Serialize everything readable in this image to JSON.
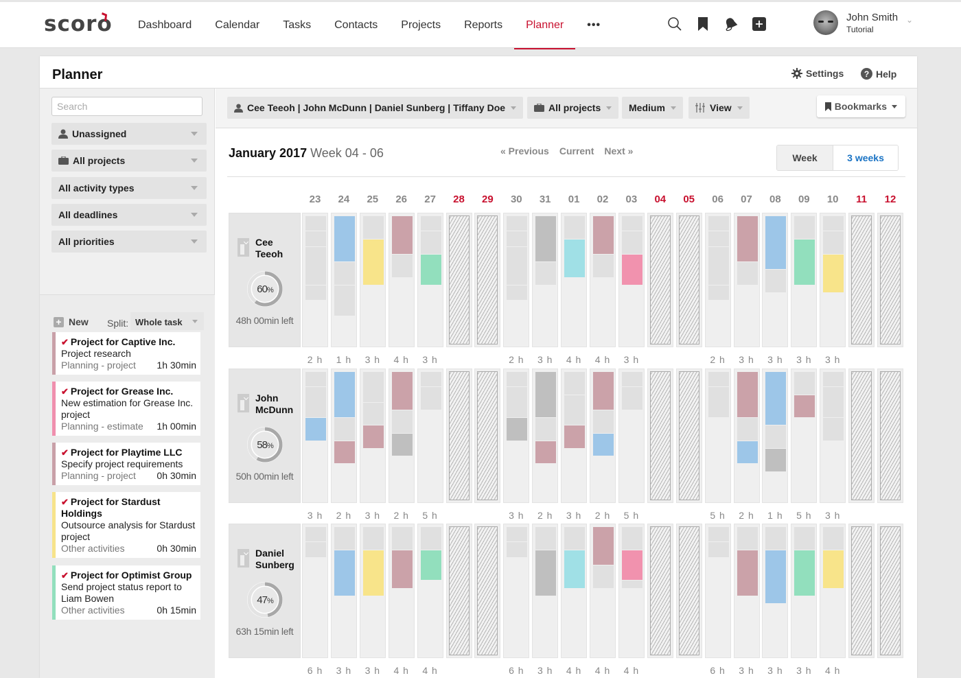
{
  "app": {
    "logo": "scoro",
    "nav": [
      {
        "label": "Dashboard",
        "active": false
      },
      {
        "label": "Calendar",
        "active": false
      },
      {
        "label": "Tasks",
        "active": false
      },
      {
        "label": "Contacts",
        "active": false
      },
      {
        "label": "Projects",
        "active": false
      },
      {
        "label": "Reports",
        "active": false
      },
      {
        "label": "Planner",
        "active": true
      }
    ],
    "nav_more": "•••",
    "icons": [
      "search-icon",
      "bookmark-icon",
      "bell-icon",
      "add-icon"
    ],
    "user": {
      "name": "John Smith",
      "role": "Tutorial"
    }
  },
  "page": {
    "title": "Planner",
    "settings_label": "Settings",
    "help_label": "Help"
  },
  "sidebar": {
    "search_placeholder": "Search",
    "filters": [
      {
        "label": "Unassigned",
        "icon": "user-icon"
      },
      {
        "label": "All projects",
        "icon": "briefcase-icon"
      },
      {
        "label": "All activity types",
        "icon": ""
      },
      {
        "label": "All deadlines",
        "icon": ""
      },
      {
        "label": "All priorities",
        "icon": ""
      }
    ],
    "new_label": "New",
    "split_label": "Split:",
    "split_value": "Whole task",
    "tasks": [
      {
        "project": "Project for Captive Inc.",
        "desc": "Project research",
        "type": "Planning - project",
        "time": "1h 30min",
        "color": "#c9a0a8"
      },
      {
        "project": "Project for Grease Inc.",
        "desc": "New estimation for Grease Inc. project",
        "type": "Planning - estimate",
        "time": "1h 00min",
        "color": "#f08fae"
      },
      {
        "project": "Project for Playtime LLC",
        "desc": "Specify project requirements",
        "type": "Planning - project",
        "time": "0h 30min",
        "color": "#c9a0a8"
      },
      {
        "project": "Project for Stardust Holdings",
        "desc": "Outsource analysis for Stardust project",
        "type": "Other activities",
        "time": "0h 30min",
        "color": "#f7e38a"
      },
      {
        "project": "Project for Optimist Group",
        "desc": "Send project status report to Liam Bowen",
        "type": "Other activities",
        "time": "0h 15min",
        "color": "#92dfbd"
      }
    ]
  },
  "toolbar": {
    "users_label": "Cee Teeoh | John McDunn | Daniel Sunberg | Tiffany Doe",
    "projects_label": "All projects",
    "size_label": "Medium",
    "view_label": "View",
    "bookmarks_label": "Bookmarks"
  },
  "period": {
    "month": "January 2017",
    "weeks": "Week 04 - 06",
    "prev_label": "« Previous",
    "current_label": "Current",
    "next_label": "Next »",
    "range_week": "Week",
    "range_3weeks": "3 weeks",
    "range_selected": "3 weeks"
  },
  "colors": {
    "accent": "#c8102e",
    "link": "#1a73c4",
    "empty": "#e0e0e0",
    "blue": "#9dc6e8",
    "yellow": "#f8e48a",
    "rose": "#cba2a9",
    "green": "#92dfbd",
    "grey": "#bfbfbf",
    "cyan": "#a0e0e6",
    "pink": "#f192ae"
  },
  "days": [
    {
      "d": "23",
      "weekend": false
    },
    {
      "d": "24",
      "weekend": false
    },
    {
      "d": "25",
      "weekend": false
    },
    {
      "d": "26",
      "weekend": false
    },
    {
      "d": "27",
      "weekend": false
    },
    {
      "d": "28",
      "weekend": true
    },
    {
      "d": "29",
      "weekend": true
    },
    {
      "d": "30",
      "weekend": false
    },
    {
      "d": "31",
      "weekend": false
    },
    {
      "d": "01",
      "weekend": false
    },
    {
      "d": "02",
      "weekend": false
    },
    {
      "d": "03",
      "weekend": false
    },
    {
      "d": "04",
      "weekend": true
    },
    {
      "d": "05",
      "weekend": true
    },
    {
      "d": "06",
      "weekend": false
    },
    {
      "d": "07",
      "weekend": false
    },
    {
      "d": "08",
      "weekend": false
    },
    {
      "d": "09",
      "weekend": false
    },
    {
      "d": "10",
      "weekend": false
    },
    {
      "d": "11",
      "weekend": true
    },
    {
      "d": "12",
      "weekend": true
    }
  ],
  "people": [
    {
      "first": "Cee",
      "last": "Teeoh",
      "percent": 60,
      "left": "48h 00min left",
      "hours": [
        "2 h",
        "1 h",
        "3 h",
        "4 h",
        "3 h",
        "",
        "",
        "2 h",
        "3 h",
        "4 h",
        "4 h",
        "3 h",
        "",
        "",
        "2 h",
        "3 h",
        "3 h",
        "3 h",
        "3 h",
        "",
        ""
      ],
      "blocks": [
        [
          [
            0,
            2,
            "empty"
          ],
          [
            2,
            2,
            "empty"
          ],
          [
            4,
            5,
            "empty"
          ],
          [
            9,
            2,
            "empty"
          ]
        ],
        [
          [
            0,
            6,
            "blue"
          ],
          [
            6,
            3,
            "empty"
          ],
          [
            9,
            4,
            "empty"
          ]
        ],
        [
          [
            0,
            3,
            "empty"
          ],
          [
            3,
            6,
            "yellow"
          ]
        ],
        [
          [
            0,
            5,
            "rose"
          ],
          [
            5,
            3,
            "empty"
          ]
        ],
        [
          [
            0,
            2,
            "empty"
          ],
          [
            2,
            3,
            "empty"
          ],
          [
            5,
            4,
            "green"
          ]
        ],
        null,
        null,
        [
          [
            0,
            2,
            "empty"
          ],
          [
            2,
            2,
            "empty"
          ],
          [
            4,
            5,
            "empty"
          ],
          [
            9,
            2,
            "empty"
          ]
        ],
        [
          [
            0,
            6,
            "grey"
          ],
          [
            6,
            3,
            "empty"
          ]
        ],
        [
          [
            0,
            3,
            "empty"
          ],
          [
            3,
            5,
            "cyan"
          ]
        ],
        [
          [
            0,
            5,
            "rose"
          ],
          [
            5,
            3,
            "empty"
          ]
        ],
        [
          [
            0,
            2,
            "empty"
          ],
          [
            2,
            3,
            "empty"
          ],
          [
            5,
            4,
            "pink"
          ]
        ],
        null,
        null,
        [
          [
            0,
            2,
            "empty"
          ],
          [
            2,
            2,
            "empty"
          ],
          [
            4,
            5,
            "empty"
          ],
          [
            9,
            2,
            "empty"
          ]
        ],
        [
          [
            0,
            6,
            "rose"
          ],
          [
            6,
            3,
            "empty"
          ]
        ],
        [
          [
            0,
            7,
            "blue"
          ],
          [
            7,
            3,
            "empty"
          ]
        ],
        [
          [
            0,
            3,
            "empty"
          ],
          [
            3,
            6,
            "green"
          ]
        ],
        [
          [
            0,
            2,
            "empty"
          ],
          [
            2,
            3,
            "empty"
          ],
          [
            5,
            5,
            "yellow"
          ]
        ],
        null,
        null
      ]
    },
    {
      "first": "John",
      "last": "McDunn",
      "percent": 58,
      "left": "50h 00min left",
      "hours": [
        "3 h",
        "2 h",
        "3 h",
        "2 h",
        "5 h",
        "",
        "",
        "3 h",
        "2 h",
        "3 h",
        "2 h",
        "5 h",
        "",
        "",
        "5 h",
        "2 h",
        "1 h",
        "5 h",
        "3 h",
        "",
        ""
      ],
      "blocks": [
        [
          [
            0,
            2,
            "empty"
          ],
          [
            2,
            4,
            "empty"
          ],
          [
            6,
            3,
            "blue"
          ]
        ],
        [
          [
            0,
            6,
            "blue"
          ],
          [
            6,
            3,
            "empty"
          ],
          [
            9,
            3,
            "rose"
          ]
        ],
        [
          [
            0,
            4,
            "empty"
          ],
          [
            4,
            3,
            "empty"
          ],
          [
            7,
            3,
            "rose"
          ]
        ],
        [
          [
            0,
            5,
            "rose"
          ],
          [
            5,
            3,
            "empty"
          ],
          [
            8,
            3,
            "grey"
          ]
        ],
        [
          [
            0,
            2,
            "empty"
          ],
          [
            2,
            3,
            "empty"
          ]
        ],
        null,
        null,
        [
          [
            0,
            2,
            "empty"
          ],
          [
            2,
            4,
            "empty"
          ],
          [
            6,
            3,
            "grey"
          ]
        ],
        [
          [
            0,
            6,
            "grey"
          ],
          [
            6,
            3,
            "empty"
          ],
          [
            9,
            3,
            "rose"
          ]
        ],
        [
          [
            0,
            3,
            "empty"
          ],
          [
            3,
            4,
            "empty"
          ],
          [
            7,
            3,
            "rose"
          ]
        ],
        [
          [
            0,
            5,
            "rose"
          ],
          [
            5,
            3,
            "empty"
          ],
          [
            8,
            3,
            "blue"
          ]
        ],
        [
          [
            0,
            2,
            "empty"
          ],
          [
            2,
            3,
            "empty"
          ]
        ],
        null,
        null,
        [
          [
            0,
            2,
            "empty"
          ],
          [
            2,
            4,
            "empty"
          ]
        ],
        [
          [
            0,
            6,
            "rose"
          ],
          [
            6,
            3,
            "empty"
          ],
          [
            9,
            3,
            "blue"
          ]
        ],
        [
          [
            0,
            7,
            "blue"
          ],
          [
            7,
            3,
            "empty"
          ],
          [
            10,
            3,
            "grey"
          ]
        ],
        [
          [
            0,
            3,
            "empty"
          ],
          [
            3,
            3,
            "rose"
          ]
        ],
        [
          [
            0,
            2,
            "empty"
          ],
          [
            2,
            4,
            "empty"
          ],
          [
            6,
            3,
            "empty"
          ]
        ],
        null,
        null
      ]
    },
    {
      "first": "Daniel",
      "last": "Sunberg",
      "percent": 47,
      "left": "63h 15min left",
      "hours": [
        "6 h",
        "3 h",
        "3 h",
        "4 h",
        "4 h",
        "",
        "",
        "6 h",
        "3 h",
        "4 h",
        "4 h",
        "4 h",
        "",
        "",
        "6 h",
        "3 h",
        "3 h",
        "3 h",
        "4 h",
        "",
        ""
      ],
      "blocks": [
        [
          [
            0,
            2,
            "empty"
          ],
          [
            2,
            2,
            "empty"
          ]
        ],
        [
          [
            0,
            3,
            "empty"
          ],
          [
            3,
            6,
            "blue"
          ]
        ],
        [
          [
            0,
            3,
            "empty"
          ],
          [
            3,
            6,
            "yellow"
          ]
        ],
        [
          [
            0,
            3,
            "empty"
          ],
          [
            3,
            5,
            "rose"
          ]
        ],
        [
          [
            0,
            3,
            "empty"
          ],
          [
            3,
            4,
            "green"
          ]
        ],
        null,
        null,
        [
          [
            0,
            2,
            "empty"
          ],
          [
            2,
            2,
            "empty"
          ]
        ],
        [
          [
            0,
            3,
            "empty"
          ],
          [
            3,
            6,
            "grey"
          ]
        ],
        [
          [
            0,
            3,
            "empty"
          ],
          [
            3,
            5,
            "cyan"
          ]
        ],
        [
          [
            0,
            5,
            "rose"
          ],
          [
            5,
            3,
            "empty"
          ]
        ],
        [
          [
            0,
            3,
            "empty"
          ],
          [
            3,
            4,
            "pink"
          ],
          [
            7,
            1,
            "empty"
          ]
        ],
        null,
        null,
        [
          [
            0,
            2,
            "empty"
          ],
          [
            2,
            2,
            "empty"
          ]
        ],
        [
          [
            0,
            3,
            "empty"
          ],
          [
            3,
            6,
            "rose"
          ]
        ],
        [
          [
            0,
            3,
            "empty"
          ],
          [
            3,
            7,
            "blue"
          ]
        ],
        [
          [
            0,
            3,
            "empty"
          ],
          [
            3,
            6,
            "green"
          ]
        ],
        [
          [
            0,
            3,
            "empty"
          ],
          [
            3,
            5,
            "yellow"
          ]
        ],
        null,
        null
      ]
    }
  ]
}
